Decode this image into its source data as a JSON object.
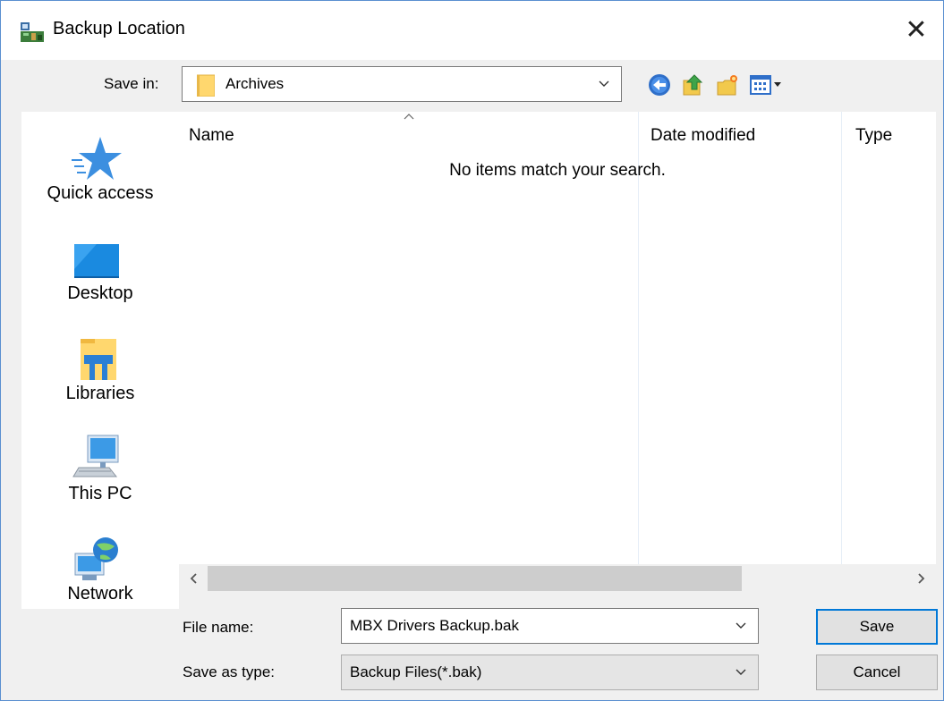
{
  "window": {
    "title": "Backup Location",
    "close_symbol": "✕"
  },
  "header": {
    "save_in_label": "Save in:",
    "save_in_value": "Archives",
    "toolbar": [
      "back-icon",
      "up-folder-icon",
      "new-folder-icon",
      "view-menu-icon"
    ]
  },
  "places": [
    {
      "label": "Quick access",
      "icon": "quick-access-star-icon"
    },
    {
      "label": "Desktop",
      "icon": "desktop-icon"
    },
    {
      "label": "Libraries",
      "icon": "libraries-icon"
    },
    {
      "label": "This PC",
      "icon": "this-pc-icon"
    },
    {
      "label": "Network",
      "icon": "network-icon"
    }
  ],
  "file_list": {
    "columns": [
      "Name",
      "Date modified",
      "Type"
    ],
    "sort_column": "Name",
    "empty_message": "No items match your search."
  },
  "footer": {
    "file_name_label": "File name:",
    "file_name_value": "MBX Drivers Backup.bak",
    "save_type_label": "Save as type:",
    "save_type_value": "Backup Files(*.bak)",
    "save_button": "Save",
    "cancel_button": "Cancel"
  },
  "colors": {
    "accent": "#0078d7",
    "folder": "#ffd76e"
  }
}
